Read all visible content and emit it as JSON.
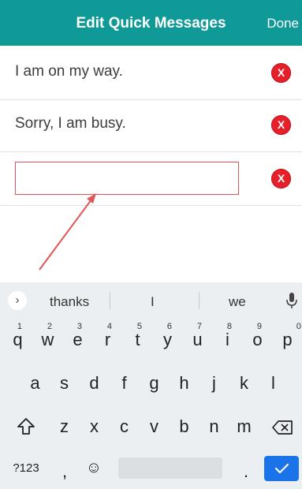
{
  "header": {
    "title": "Edit Quick Messages",
    "done_label": "Done"
  },
  "messages": [
    {
      "text": "I am on my way."
    },
    {
      "text": "Sorry, I am busy."
    }
  ],
  "new_message": {
    "value": ""
  },
  "delete_label": "X",
  "keyboard": {
    "suggestions": [
      "thanks",
      "I",
      "we"
    ],
    "row1": [
      {
        "label": "q",
        "hint": "1"
      },
      {
        "label": "w",
        "hint": "2"
      },
      {
        "label": "e",
        "hint": "3"
      },
      {
        "label": "r",
        "hint": "4"
      },
      {
        "label": "t",
        "hint": "5"
      },
      {
        "label": "y",
        "hint": "6"
      },
      {
        "label": "u",
        "hint": "7"
      },
      {
        "label": "i",
        "hint": "8"
      },
      {
        "label": "o",
        "hint": "9"
      },
      {
        "label": "p",
        "hint": "0"
      }
    ],
    "row2": [
      "a",
      "s",
      "d",
      "f",
      "g",
      "h",
      "j",
      "k",
      "l"
    ],
    "row3": [
      "z",
      "x",
      "c",
      "v",
      "b",
      "n",
      "m"
    ],
    "symbols_label": "?123",
    "comma_label": ",",
    "emoji_label": "☺",
    "period_label": "."
  },
  "colors": {
    "header": "#0f9a98",
    "delete": "#e5202b",
    "highlight": "#e05555",
    "enter": "#1a73e8"
  }
}
